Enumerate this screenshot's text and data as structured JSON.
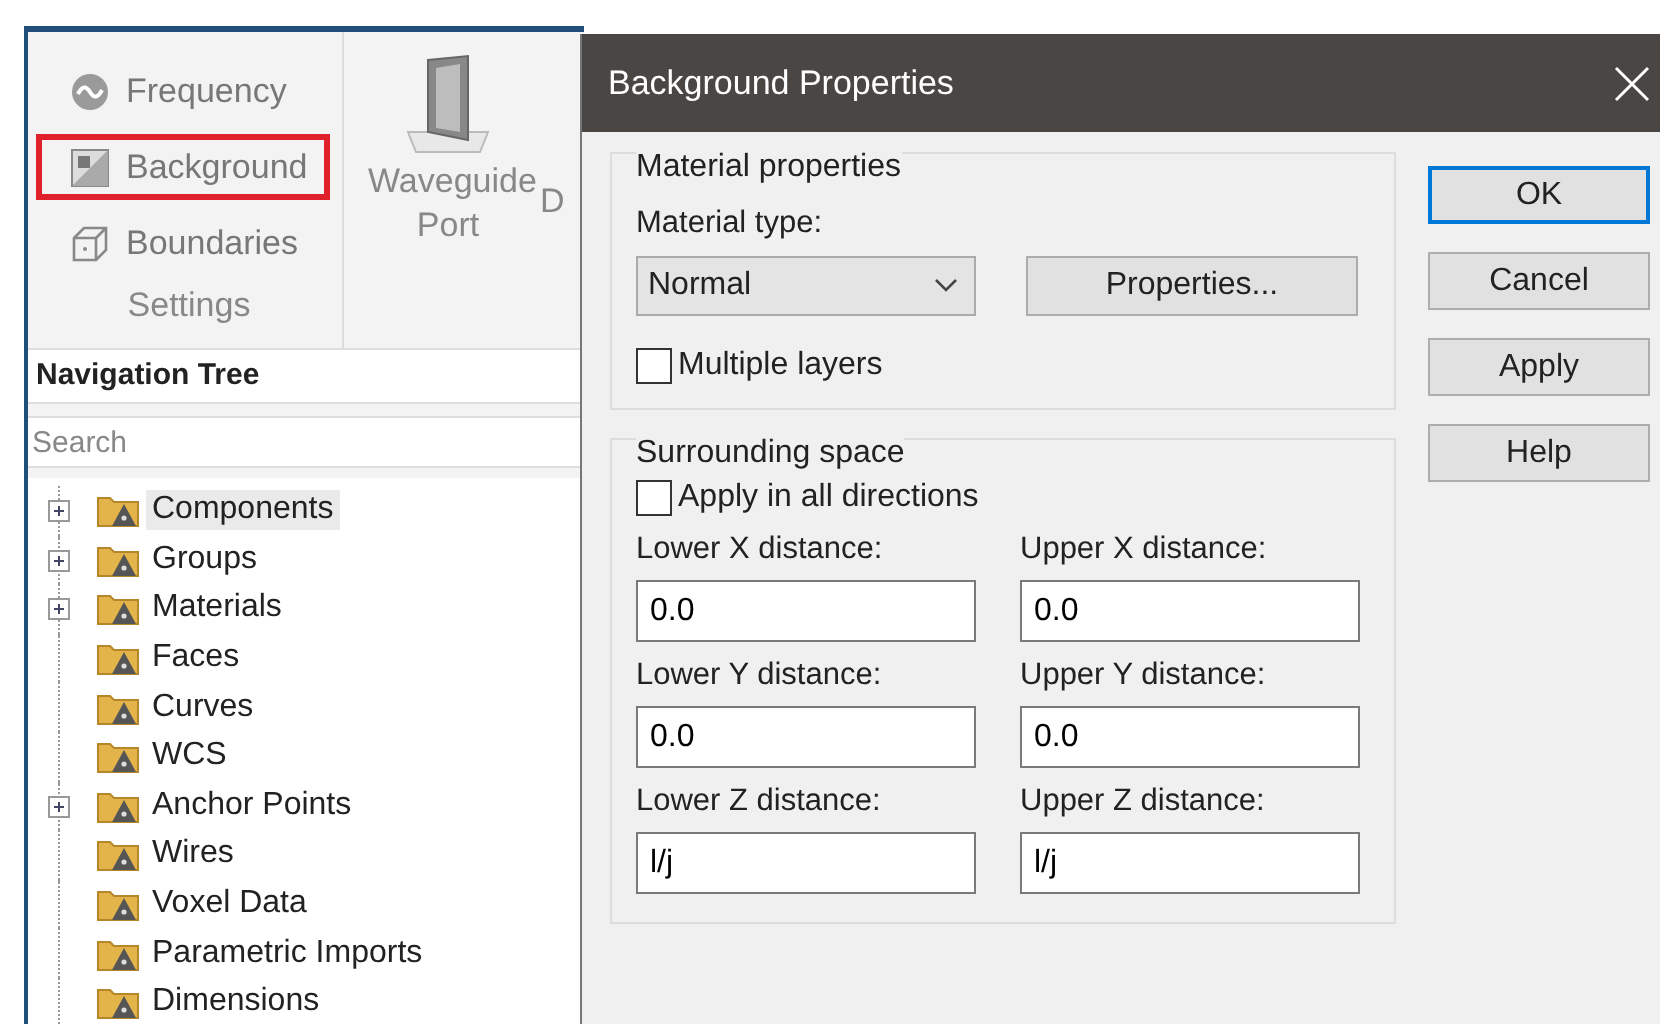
{
  "ribbon": {
    "settings_items": [
      {
        "label": "Frequency",
        "kind": "frequency",
        "highlighted": false
      },
      {
        "label": "Background",
        "kind": "background",
        "highlighted": true
      },
      {
        "label": "Boundaries",
        "kind": "boundaries",
        "highlighted": false
      }
    ],
    "group_label": "Settings",
    "large_buttons": [
      {
        "label": "Waveguide Port"
      },
      {
        "label": "D"
      }
    ]
  },
  "navigation_tree": {
    "title": "Navigation Tree",
    "search": {
      "placeholder": "Search"
    },
    "items": [
      {
        "label": "Components",
        "expandable": true,
        "selected": true
      },
      {
        "label": "Groups",
        "expandable": true,
        "selected": false
      },
      {
        "label": "Materials",
        "expandable": true,
        "selected": false
      },
      {
        "label": "Faces",
        "expandable": false,
        "selected": false
      },
      {
        "label": "Curves",
        "expandable": false,
        "selected": false
      },
      {
        "label": "WCS",
        "expandable": false,
        "selected": false
      },
      {
        "label": "Anchor Points",
        "expandable": true,
        "selected": false
      },
      {
        "label": "Wires",
        "expandable": false,
        "selected": false
      },
      {
        "label": "Voxel Data",
        "expandable": false,
        "selected": false
      },
      {
        "label": "Parametric Imports",
        "expandable": false,
        "selected": false
      },
      {
        "label": "Dimensions",
        "expandable": false,
        "selected": false
      }
    ]
  },
  "dialog": {
    "title": "Background Properties",
    "material_properties": {
      "title": "Material properties",
      "type_label": "Material type:",
      "type_value": "Normal",
      "properties_button": "Properties...",
      "multiple_layers": {
        "label": "Multiple layers",
        "checked": false
      }
    },
    "surrounding_space": {
      "title": "Surrounding space",
      "apply_all": {
        "label": "Apply in all directions",
        "checked": false
      },
      "fields": [
        {
          "label": "Lower X distance:",
          "value": "0.0"
        },
        {
          "label": "Upper X distance:",
          "value": "0.0"
        },
        {
          "label": "Lower Y distance:",
          "value": "0.0"
        },
        {
          "label": "Upper Y distance:",
          "value": "0.0"
        },
        {
          "label": "Lower Z distance:",
          "value": "l/j"
        },
        {
          "label": "Upper Z distance:",
          "value": "l/j"
        }
      ]
    },
    "buttons": [
      {
        "label": "OK",
        "default": true
      },
      {
        "label": "Cancel",
        "default": false
      },
      {
        "label": "Apply",
        "default": false
      },
      {
        "label": "Help",
        "default": false
      }
    ]
  }
}
